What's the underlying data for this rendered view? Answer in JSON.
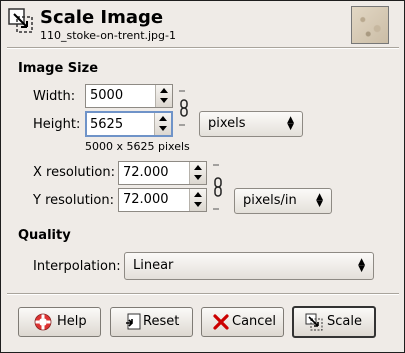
{
  "header": {
    "title": "Scale Image",
    "subtitle": "110_stoke-on-trent.jpg-1"
  },
  "image_size": {
    "section_label": "Image Size",
    "width_label": "Width:",
    "width_value": "5000",
    "height_label": "Height:",
    "height_value": "5625",
    "size_note": "5000 x 5625 pixels",
    "unit": "pixels"
  },
  "resolution": {
    "x_label": "X resolution:",
    "x_value": "72.000",
    "y_label": "Y resolution:",
    "y_value": "72.000",
    "unit": "pixels/in"
  },
  "quality": {
    "section_label": "Quality",
    "interpolation_label": "Interpolation:",
    "interpolation_value": "Linear"
  },
  "buttons": {
    "help": "Help",
    "reset": "Reset",
    "cancel": "Cancel",
    "scale": "Scale"
  },
  "icons": [
    "scale-image-icon",
    "image-thumbnail",
    "chain-icon",
    "help-lifebuoy-icon",
    "reset-icon",
    "cancel-x-icon",
    "scale-icon"
  ]
}
